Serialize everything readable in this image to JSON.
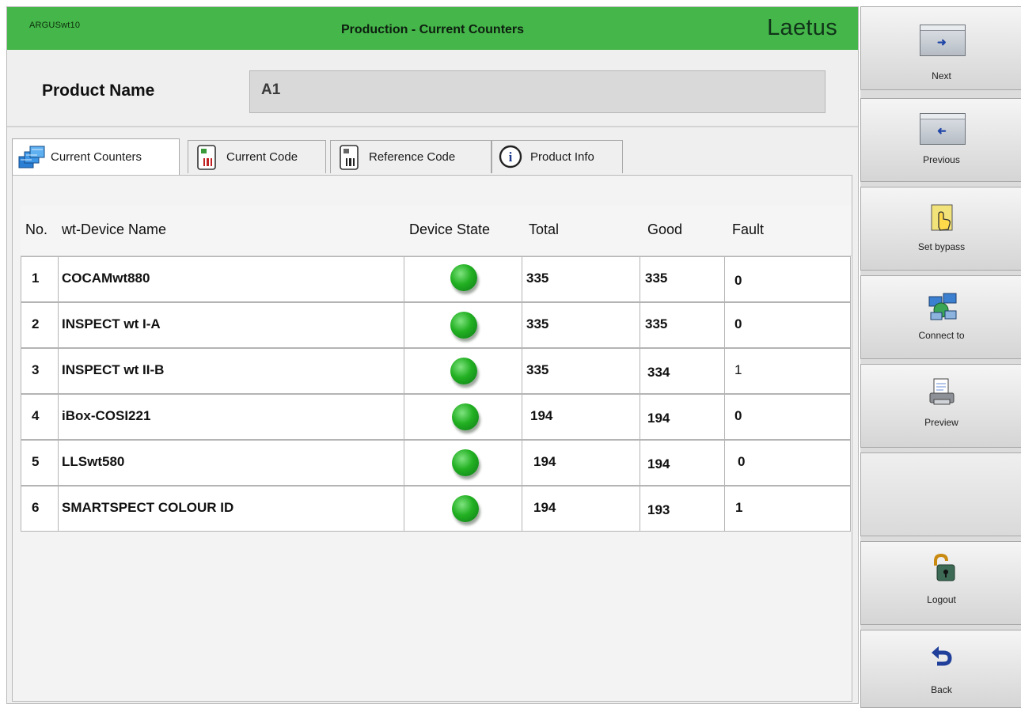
{
  "header": {
    "brand": "ARGUSwt10",
    "title": "Production - Current Counters",
    "logo": "Laetus"
  },
  "product": {
    "label": "Product Name",
    "value": "A1"
  },
  "tabs": [
    {
      "label": "Current Counters",
      "icon": "counters-icon",
      "active": true
    },
    {
      "label": "Current Code",
      "icon": "barcode-doc-icon",
      "active": false
    },
    {
      "label": "Reference Code",
      "icon": "barcode-reference-icon",
      "active": false
    },
    {
      "label": "Product Info",
      "icon": "info-icon",
      "active": false
    }
  ],
  "table": {
    "columns": [
      "No.",
      "wt-Device Name",
      "Device State",
      "Total",
      "Good",
      "Fault"
    ],
    "rows": [
      {
        "no": "1",
        "name": "COCAMwt880",
        "state": "ok",
        "total": "335",
        "good": "335",
        "fault": "0"
      },
      {
        "no": "2",
        "name": "INSPECT wt I-A",
        "state": "ok",
        "total": "335",
        "good": "335",
        "fault": "0"
      },
      {
        "no": "3",
        "name": "INSPECT wt II-B",
        "state": "ok",
        "total": "335",
        "good": "334",
        "fault": "1"
      },
      {
        "no": "4",
        "name": "iBox-COSI221",
        "state": "ok",
        "total": "194",
        "good": "194",
        "fault": "0"
      },
      {
        "no": "5",
        "name": "LLSwt580",
        "state": "ok",
        "total": "194",
        "good": "194",
        "fault": "0"
      },
      {
        "no": "6",
        "name": "SMARTSPECT COLOUR ID",
        "state": "ok",
        "total": "194",
        "good": "193",
        "fault": "1"
      }
    ]
  },
  "sidebar": {
    "buttons": [
      {
        "label": "Next",
        "icon": "next-icon"
      },
      {
        "label": "Previous",
        "icon": "previous-icon"
      },
      {
        "label": "Set bypass",
        "icon": "hand-pointer-icon"
      },
      {
        "label": "Connect to",
        "icon": "network-icon"
      },
      {
        "label": "Preview",
        "icon": "print-preview-icon"
      },
      {
        "label": "",
        "icon": ""
      },
      {
        "label": "Logout",
        "icon": "padlock-icon"
      },
      {
        "label": "Back",
        "icon": "back-arrow-icon"
      }
    ]
  },
  "colors": {
    "titlebar": "#45b649",
    "status_ok": "#22b022"
  }
}
